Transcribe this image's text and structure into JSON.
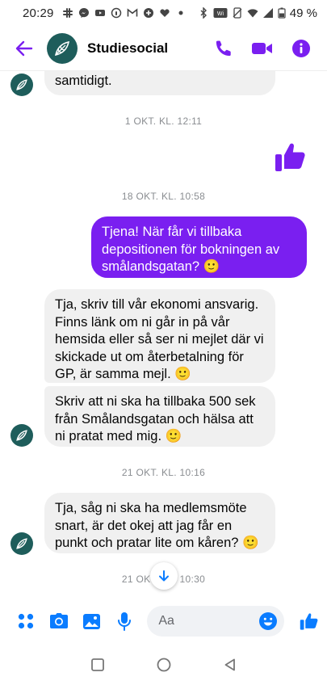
{
  "status_bar": {
    "time": "20:29",
    "battery": "49 %"
  },
  "header": {
    "title": "Studiesocial"
  },
  "messages": {
    "m0_text": "samtidigt.",
    "ts1": "1 OKT. KL. 12:11",
    "ts2": "18 OKT. KL. 10:58",
    "m2_text": "Tjena! När får vi tillbaka depositionen för bokningen av smålandsgatan? 🙂",
    "m3_text": "Tja, skriv till vår ekonomi ansvarig. Finns länk om ni går in på vår hemsida eller så ser ni mejlet där vi skickade ut om återbetalning för GP, är samma mejl. 🙂",
    "m4_text": "Skriv att ni ska ha tillbaka 500 sek från Smålandsgatan och hälsa att ni pratat med mig. 🙂",
    "ts3": "21 OKT. KL. 10:16",
    "m5_text": "Tja, såg ni ska ha medlemsmöte snart, är det okej att jag får en punkt och pratar lite om kåren? 🙂",
    "ts4": "21 OKT. KL. 10:30"
  },
  "composer": {
    "placeholder": "Aa"
  },
  "colors": {
    "accent": "#7a1ff0",
    "blue": "#0a7cff",
    "avatar_bg": "#1e5d5b",
    "incoming_bg": "#f0f0f0"
  },
  "icons": {
    "header": [
      "back-arrow-icon",
      "phone-icon",
      "video-camera-icon",
      "info-icon"
    ],
    "composer": [
      "apps-menu-icon",
      "camera-icon",
      "gallery-icon",
      "microphone-icon",
      "emoji-icon",
      "thumbs-up-icon"
    ],
    "nav": [
      "recents-icon",
      "home-icon",
      "back-icon"
    ]
  }
}
